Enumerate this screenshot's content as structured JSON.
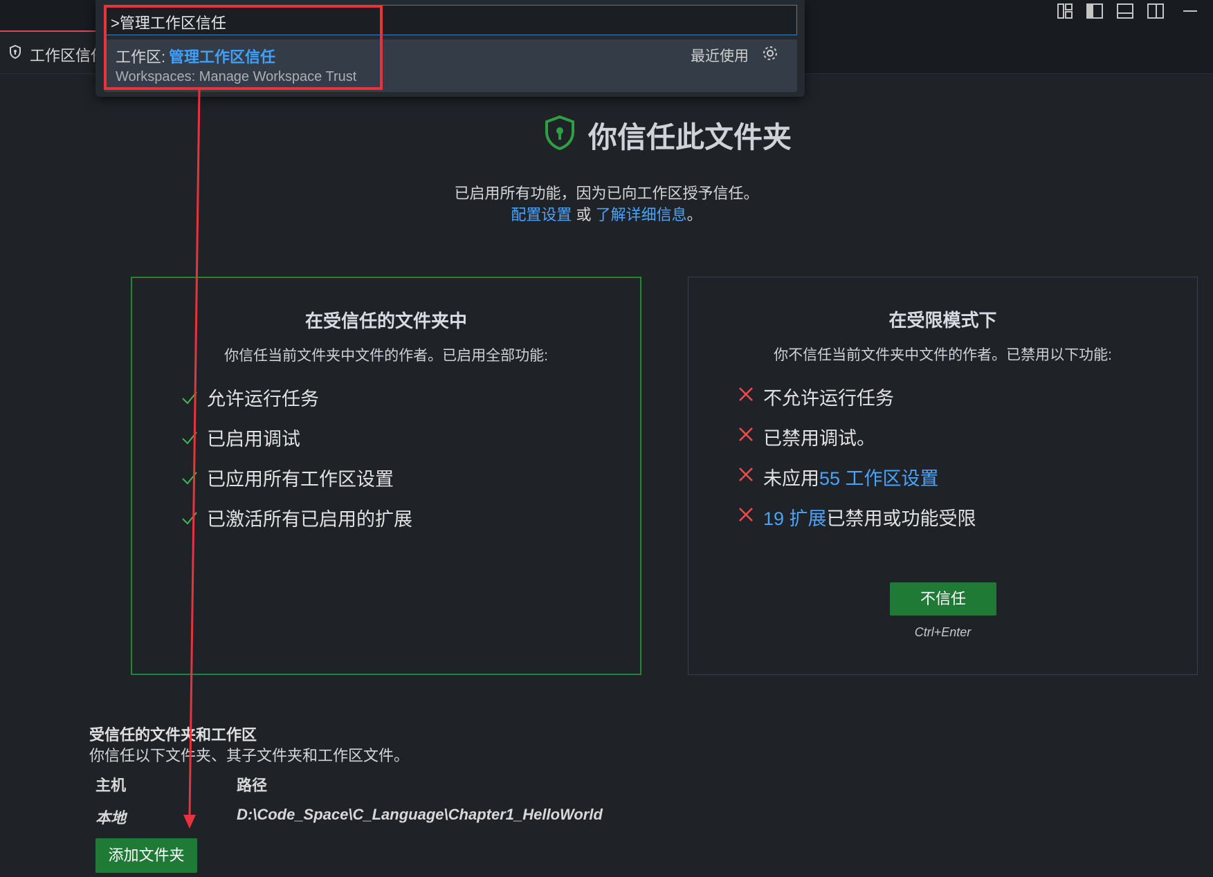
{
  "editor_tab": {
    "label": "工作区信任",
    "icon": "shield-icon"
  },
  "layout_controls": [
    "customize-layout-icon",
    "toggle-primary-sidebar-icon",
    "toggle-panel-icon",
    "toggle-secondary-sidebar-icon",
    "minimize-icon"
  ],
  "command_palette": {
    "input_value": ">管理工作区信任",
    "result": {
      "category": "工作区: ",
      "title_match": "管理工作区信任",
      "detail": "Workspaces: Manage Workspace Trust",
      "recent_label": "最近使用",
      "gear_icon": "gear-icon"
    }
  },
  "header": {
    "title": "你信任此文件夹",
    "subtitle": "已启用所有功能，因为已向工作区授予信任。",
    "link_configure": "配置设置",
    "or_text": " 或 ",
    "link_learn_more": "了解详细信息",
    "period": "。"
  },
  "trusted_panel": {
    "title": "在受信任的文件夹中",
    "description": "你信任当前文件夹中文件的作者。已启用全部功能:",
    "features": [
      "允许运行任务",
      "已启用调试",
      "已应用所有工作区设置",
      "已激活所有已启用的扩展"
    ]
  },
  "restricted_panel": {
    "title": "在受限模式下",
    "description": "你不信任当前文件夹中文件的作者。已禁用以下功能:",
    "features": [
      {
        "text": "不允许运行任务"
      },
      {
        "text": "已禁用调试。"
      },
      {
        "prefix": "未应用",
        "link": "55 工作区设置",
        "suffix": ""
      },
      {
        "prefix": "",
        "link": "19 扩展",
        "suffix": "已禁用或功能受限"
      }
    ],
    "button_label": "不信任",
    "shortcut": "Ctrl+Enter"
  },
  "trusted_folders": {
    "heading": "受信任的文件夹和工作区",
    "description": "你信任以下文件夹、其子文件夹和工作区文件。",
    "columns": [
      "主机",
      "路径"
    ],
    "rows": [
      {
        "host": "本地",
        "path": "D:\\Code_Space\\C_Language\\Chapter1_HelloWorld"
      }
    ],
    "add_button": "添加文件夹"
  },
  "colors": {
    "accent_green": "#238636",
    "button_green": "#1f7a35",
    "link_blue": "#4aa3ff",
    "highlight_red": "#e8333c",
    "error_red": "#f14c4c"
  }
}
